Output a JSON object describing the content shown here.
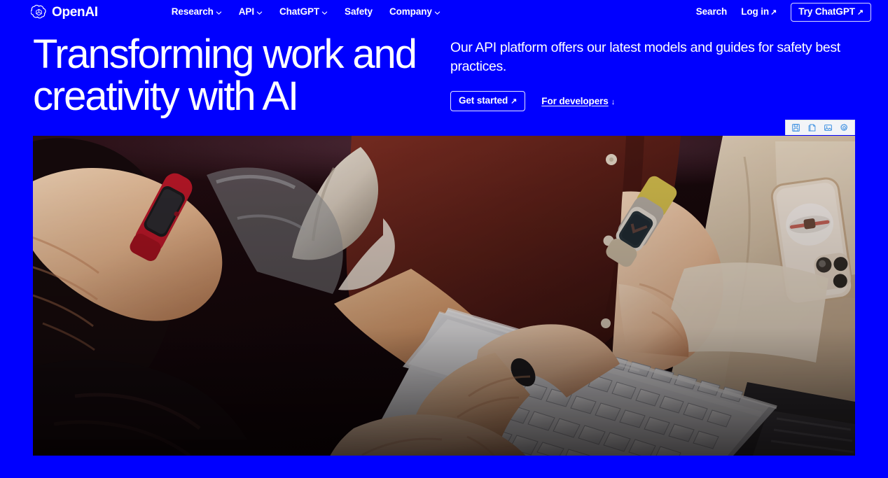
{
  "header": {
    "brand": {
      "name": "OpenAI",
      "logo_icon": "openai-blossom-logo"
    },
    "nav": [
      {
        "label": "Research",
        "has_caret": true
      },
      {
        "label": "API",
        "has_caret": true
      },
      {
        "label": "ChatGPT",
        "has_caret": true
      },
      {
        "label": "Safety",
        "has_caret": false
      },
      {
        "label": "Company",
        "has_caret": true
      }
    ],
    "search_label": "Search",
    "login_label": "Log in",
    "login_arrow": "↗",
    "cta_label": "Try ChatGPT",
    "cta_arrow": "↗"
  },
  "hero": {
    "headline": "Transforming work and\ncreativity with AI",
    "subhead": "Our API platform offers our latest models and guides for safety best practices.",
    "primary_cta": {
      "label": "Get started",
      "arrow": "↗"
    },
    "secondary_cta": {
      "label": "For developers",
      "arrow": "↓"
    }
  },
  "media": {
    "alt": "Overhead photo of people gathered around a silver laptop, hands on the keyboard, one wearing a red smartwatch and another a grey smartwatch, with a phone resting on a cushion nearby",
    "toolbar": [
      {
        "icon": "save-disk-icon",
        "label": "Save"
      },
      {
        "icon": "copy-icon",
        "label": "Copy"
      },
      {
        "icon": "image-icon",
        "label": "Image"
      },
      {
        "icon": "gear-icon",
        "label": "Settings"
      }
    ]
  },
  "colors": {
    "background": "#0000ff",
    "text": "#ffffff",
    "toolbar_bg": "#f2f4f8",
    "toolbar_icon": "#3b8fe0"
  }
}
